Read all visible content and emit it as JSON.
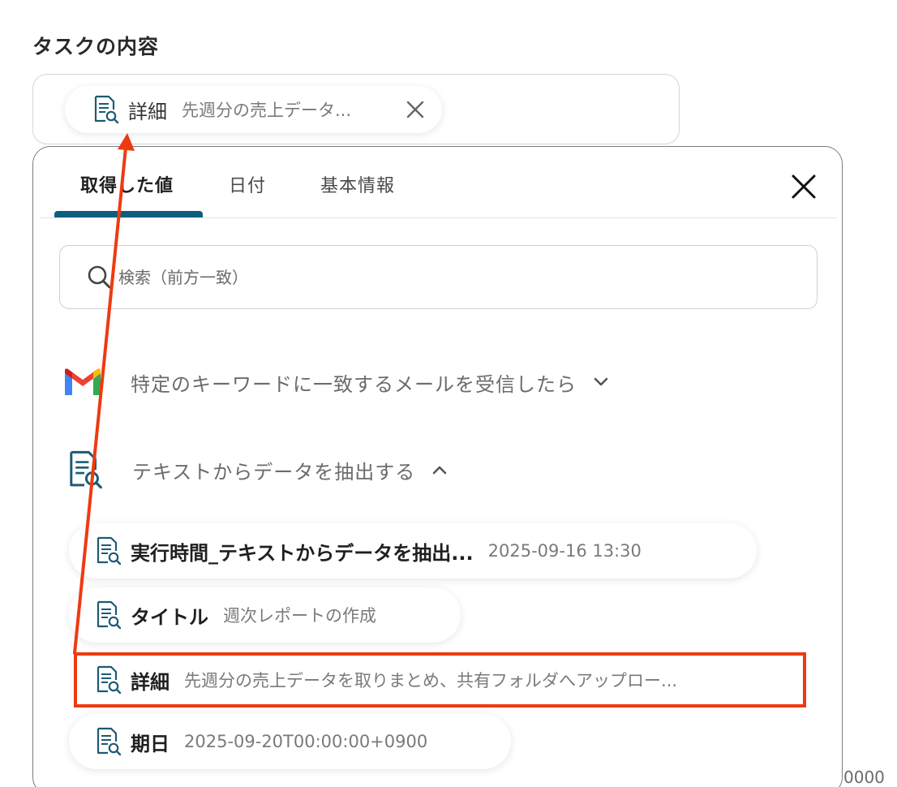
{
  "field": {
    "label": "タスクの内容",
    "chip": {
      "key": "詳細",
      "value": "先週分の売上データ..."
    }
  },
  "panel": {
    "tabs": [
      {
        "label": "取得した値",
        "active": true
      },
      {
        "label": "日付",
        "active": false
      },
      {
        "label": "基本情報",
        "active": false
      }
    ],
    "search": {
      "placeholder": "検索（前方一致）"
    },
    "sections": [
      {
        "title": "特定のキーワードに一致するメールを受信したら",
        "icon": "gmail-logo",
        "expanded": false
      },
      {
        "title": "テキストからデータを抽出する",
        "icon": "document-search-icon",
        "expanded": true
      }
    ],
    "items": [
      {
        "key": "実行時間_テキストからデータを抽出...",
        "value": "2025-09-16 13:30"
      },
      {
        "key": "タイトル",
        "value": "週次レポートの作成"
      },
      {
        "key": "詳細",
        "value": "先週分の売上データを取りまとめ、共有フォルダへアップロー...",
        "highlighted": true
      },
      {
        "key": "期日",
        "value": "2025-09-20T00:00:00+0900"
      }
    ]
  },
  "edge_text": "0000",
  "colors": {
    "accent": "#0b5e7f",
    "highlight": "#ee3a12",
    "icon": "#1c5b74"
  }
}
